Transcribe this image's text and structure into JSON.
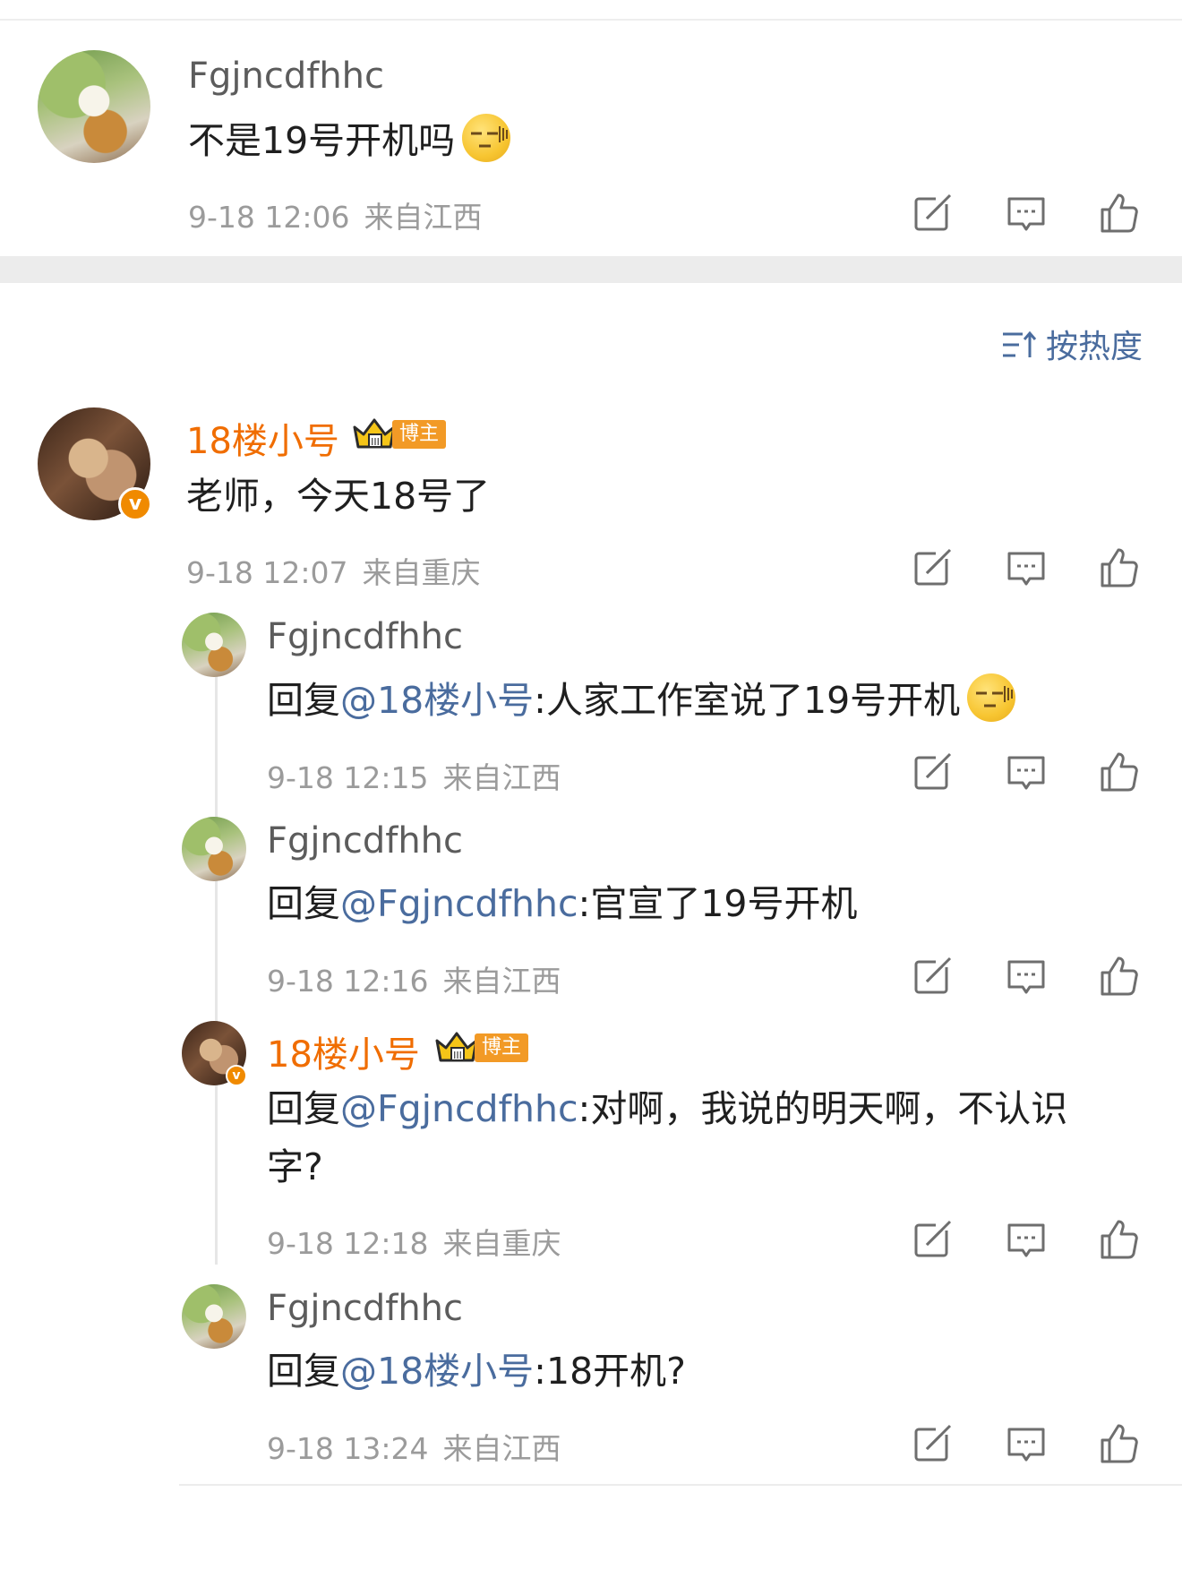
{
  "top_comment": {
    "username": "Fgjncdfhhc",
    "text": "不是19号开机吗",
    "time": "9-18 12:06",
    "location": "来自江西"
  },
  "sort": {
    "icon": "sort-icon",
    "label": "按热度"
  },
  "main_comment": {
    "username": "18楼小号",
    "badge": "博主",
    "verified": "v",
    "text": "老师，今天18号了",
    "time": "9-18 12:07",
    "location": "来自重庆"
  },
  "replies": [
    {
      "username": "Fgjncdfhhc",
      "prefix": "回复",
      "mention": "@18楼小号",
      "body": ":人家工作室说了19号开机",
      "time": "9-18 12:15",
      "location": "来自江西"
    },
    {
      "username": "Fgjncdfhhc",
      "prefix": "回复",
      "mention": "@Fgjncdfhhc",
      "body": ":官宣了19号开机",
      "time": "9-18 12:16",
      "location": "来自江西"
    },
    {
      "username": "18楼小号",
      "badge": "博主",
      "verified": "v",
      "prefix": "回复",
      "mention": "@Fgjncdfhhc",
      "body": ":对啊，我说的明天啊，不认识",
      "body_line2": "字?",
      "time": "9-18 12:18",
      "location": "来自重庆"
    },
    {
      "username": "Fgjncdfhhc",
      "prefix": "回复",
      "mention": "@18楼小号",
      "body": ":18开机?",
      "time": "9-18 13:24",
      "location": "来自江西"
    }
  ],
  "colors": {
    "link": "#4a6c9e",
    "vip_name": "#f06d00",
    "badge": "#f29a26",
    "meta": "#9b9b9b"
  }
}
